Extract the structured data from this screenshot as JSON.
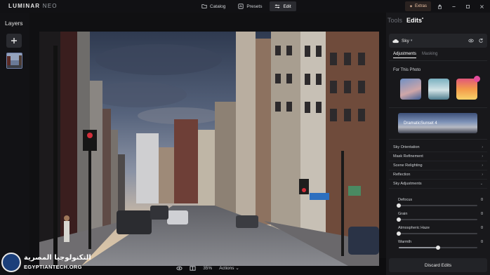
{
  "app": {
    "logo_main": "LUMINAR",
    "logo_sub": "NEO"
  },
  "topbar": {
    "modes": [
      {
        "label": "Catalog",
        "icon": "folder-icon",
        "active": false
      },
      {
        "label": "Presets",
        "icon": "presets-icon",
        "active": false
      },
      {
        "label": "Edit",
        "icon": "sliders-icon",
        "active": true
      }
    ],
    "extras_label": "Extras"
  },
  "layers": {
    "title": "Layers"
  },
  "statusbar": {
    "zoom": "35%",
    "actions": "Actions"
  },
  "watermark": {
    "arabic": "التكنولوجيا المصرية",
    "english": "EGYPTIANTECH.ORG"
  },
  "panel": {
    "tabs": [
      "Tools",
      "Edits"
    ],
    "active_tab": "Edits",
    "tool_name": "Sky",
    "subtabs": [
      "Adjustments",
      "Masking"
    ],
    "for_photo_label": "For This Photo",
    "sky_banner_label": "DramaticSunset 4",
    "sections": [
      "Sky Orientation",
      "Mask Refinement",
      "Scene Relighting",
      "Reflection",
      "Sky Adjustments"
    ],
    "sliders": [
      {
        "label": "Defocus",
        "value": "0",
        "fraction": 0
      },
      {
        "label": "Grain",
        "value": "0",
        "fraction": 0
      },
      {
        "label": "Atmospheric Haze",
        "value": "0",
        "fraction": 0
      },
      {
        "label": "Warmth",
        "value": "0",
        "fraction": 0.5
      }
    ],
    "discard_label": "Discard Edits"
  },
  "colors": {
    "accent_badge": "#e44d9c",
    "extras_text": "#f0c6a8"
  }
}
